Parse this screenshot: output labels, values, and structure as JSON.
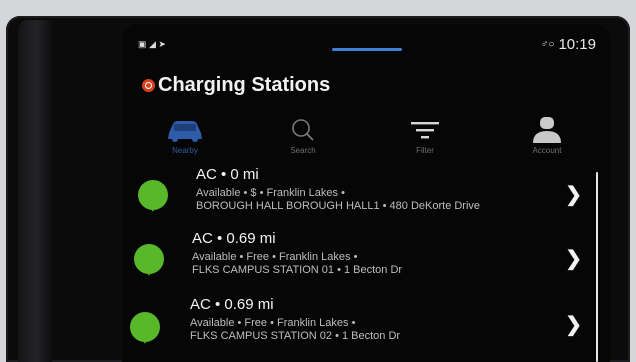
{
  "status": {
    "left_icons": "▣ ◢ ➤",
    "right_icons": "♂○",
    "time": "10:19"
  },
  "header": {
    "title": "Charging Stations"
  },
  "tabs": [
    {
      "label": "Nearby",
      "icon": "car-icon",
      "active": true
    },
    {
      "label": "Search",
      "icon": "search-icon",
      "active": false
    },
    {
      "label": "Filter",
      "icon": "filter-icon",
      "active": false
    },
    {
      "label": "Account",
      "icon": "account-icon",
      "active": false
    }
  ],
  "stations": [
    {
      "title": "AC • 0 mi",
      "status": "Available • $ • Franklin Lakes •",
      "address": "BOROUGH HALL BOROUGH HALL1 • 480 DeKorte Drive"
    },
    {
      "title": "AC • 0.69 mi",
      "status": "Available • Free • Franklin Lakes •",
      "address": "FLKS CAMPUS STATION 01 • 1 Becton Dr"
    },
    {
      "title": "AC • 0.69 mi",
      "status": "Available • Free • Franklin Lakes •",
      "address": "FLKS CAMPUS STATION 02 • 1 Becton Dr"
    }
  ],
  "colors": {
    "pin": "#58b82a",
    "active_tab": "#2f5a9e",
    "accent": "#3f7fd6"
  }
}
